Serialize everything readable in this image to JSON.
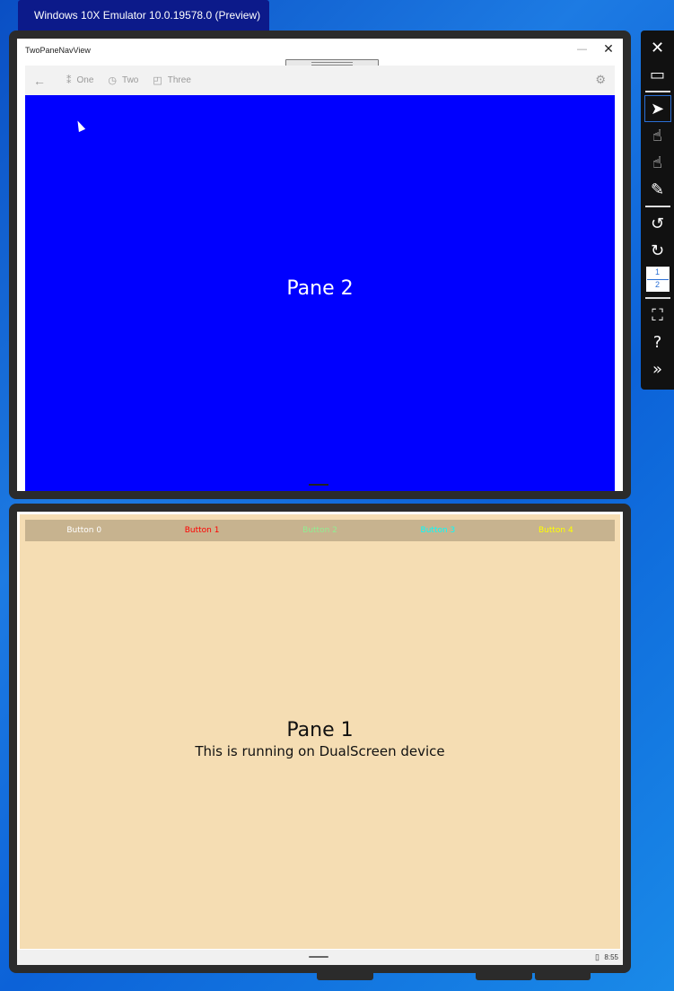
{
  "emulator": {
    "title": "Windows 10X Emulator 10.0.19578.0 (Preview)"
  },
  "window": {
    "title": "TwoPaneNavView",
    "minimize": "—",
    "close": "✕"
  },
  "navbar": {
    "back_icon": "←",
    "items": [
      {
        "label": "One",
        "icon": "⁑"
      },
      {
        "label": "Two",
        "icon": "◷"
      },
      {
        "label": "Three",
        "icon": "◰"
      }
    ],
    "settings_icon": "⚙"
  },
  "pane2": {
    "label": "Pane 2",
    "background": "#0000ff"
  },
  "pane1": {
    "title": "Pane 1",
    "subtitle": "This is running on DualScreen device",
    "background": "#f5ddb3",
    "buttons": [
      {
        "label": "Button 0",
        "color": "#ffffff"
      },
      {
        "label": "Button 1",
        "color": "#ff0000"
      },
      {
        "label": "Button 2",
        "color": "#90ee90"
      },
      {
        "label": "Button 3",
        "color": "#00ffff"
      },
      {
        "label": "Button 4",
        "color": "#ffff00"
      }
    ]
  },
  "taskbar": {
    "time": "8:55",
    "battery_icon": "▯"
  },
  "toolbar": {
    "buttons": [
      "close-icon",
      "minimize-icon",
      "pointer-icon",
      "touch-icon",
      "multi-touch-icon",
      "pen-icon",
      "rotate-left-icon",
      "rotate-right-icon",
      "fit-screen-icon",
      "help-icon",
      "more-icon"
    ],
    "screen_labels": [
      "1",
      "2"
    ]
  }
}
